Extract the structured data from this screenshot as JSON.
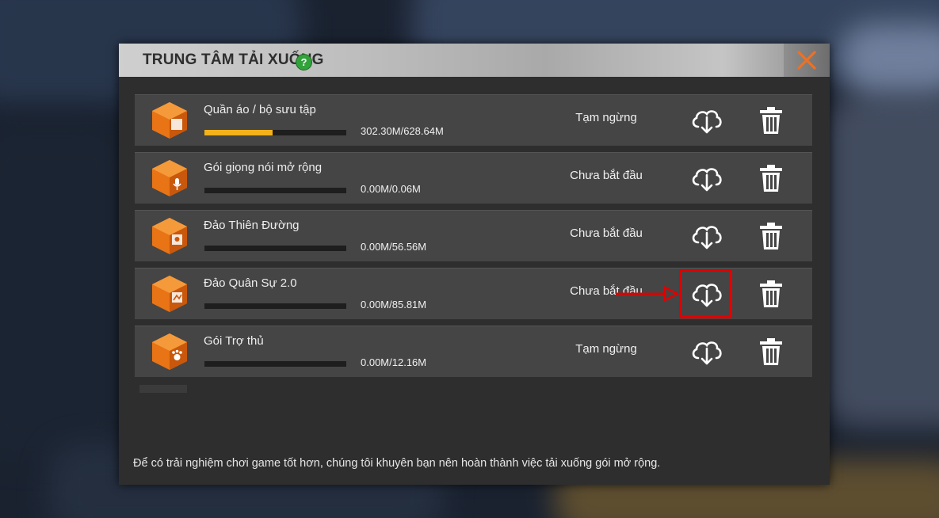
{
  "dialog": {
    "title": "TRUNG TÂM TẢI XUỐNG",
    "help_icon": "question-icon",
    "close_icon": "close-icon",
    "accent_color": "#f07020"
  },
  "downloads": [
    {
      "name": "Quần áo / bộ sưu tập",
      "size": "302.30M/628.64M",
      "progress": 0.48,
      "status": "Tạm ngừng",
      "icon": "clothing-box-icon"
    },
    {
      "name": "Gói giọng nói mở rộng",
      "size": "0.00M/0.06M",
      "progress": 0,
      "status": "Chưa bắt đầu",
      "icon": "voice-box-icon"
    },
    {
      "name": "Đảo Thiên Đường",
      "size": "0.00M/56.56M",
      "progress": 0,
      "status": "Chưa bắt đầu",
      "icon": "island-map-box-icon"
    },
    {
      "name": "Đảo Quân Sự 2.0",
      "size": "0.00M/85.81M",
      "progress": 0,
      "status": "Chưa bắt đầu",
      "icon": "military-map-box-icon"
    },
    {
      "name": "Gói Trợ thủ",
      "size": "0.00M/12.16M",
      "progress": 0,
      "status": "Tạm ngừng",
      "icon": "pet-box-icon"
    }
  ],
  "footer_note": "Để có trải nghiệm chơi game tốt hơn, chúng tôi khuyên bạn nên hoàn thành việc tải xuống gói mở rộng.",
  "colors": {
    "progress_fill": "#f3b21b",
    "row_bg": "#454545",
    "highlight": "#e00000"
  }
}
